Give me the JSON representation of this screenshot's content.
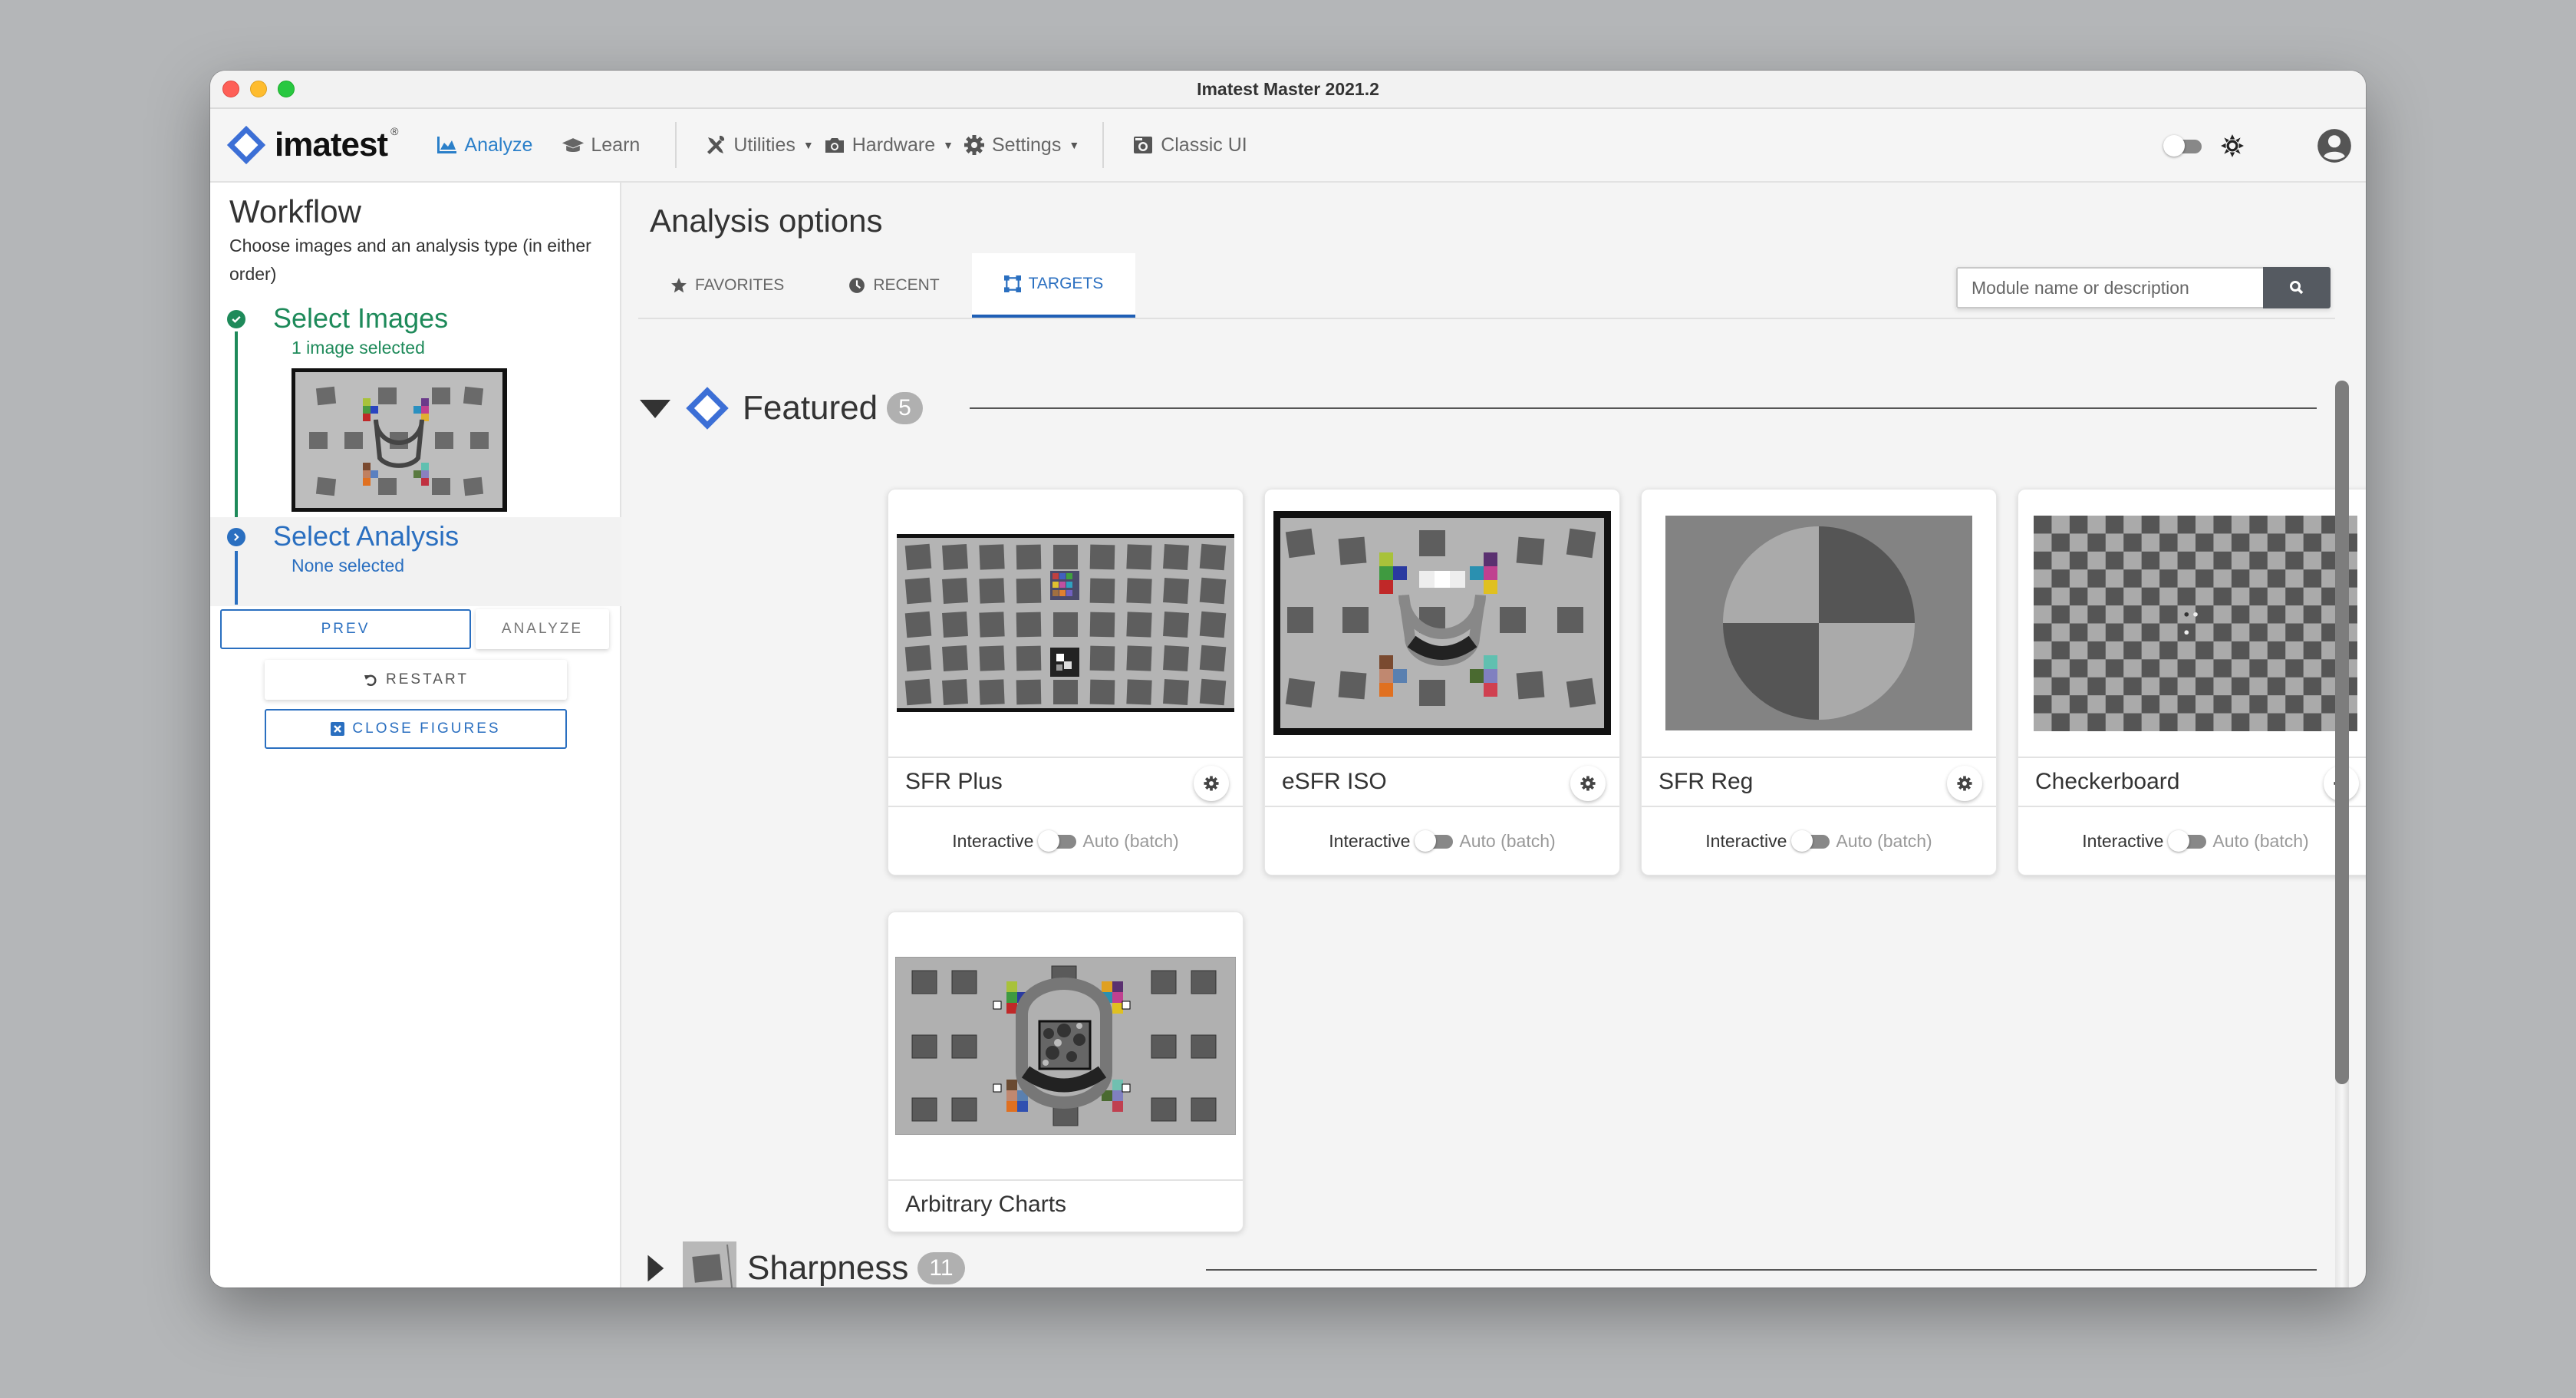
{
  "window": {
    "title": "Imatest Master 2021.2"
  },
  "toolbar": {
    "logo_text": "imatest",
    "logo_reg": "®",
    "nav": [
      {
        "label": "Analyze",
        "icon": "area-chart-icon",
        "active": true
      },
      {
        "label": "Learn",
        "icon": "graduation-cap-icon",
        "active": false
      }
    ],
    "menus": [
      {
        "label": "Utilities",
        "icon": "tools-icon",
        "has_caret": true
      },
      {
        "label": "Hardware",
        "icon": "camera-icon",
        "has_caret": true
      },
      {
        "label": "Settings",
        "icon": "gear-icon",
        "has_caret": true
      }
    ],
    "classic_ui_label": "Classic UI",
    "theme_toggle_on": false
  },
  "sidebar": {
    "title": "Workflow",
    "description": "Choose images and an analysis type (in either order)",
    "steps": [
      {
        "title": "Select Images",
        "subtitle": "1 image selected",
        "status": "complete",
        "color": "#1e8a5a"
      },
      {
        "title": "Select Analysis",
        "subtitle": "None selected",
        "status": "current",
        "color": "#2a6fc0"
      }
    ],
    "buttons": {
      "prev": "PREV",
      "analyze": "ANALYZE",
      "restart": "RESTART",
      "close_figures": "CLOSE FIGURES"
    }
  },
  "main": {
    "title": "Analysis options",
    "tabs": [
      {
        "label": "FAVORITES",
        "icon": "star-icon",
        "active": false
      },
      {
        "label": "RECENT",
        "icon": "clock-icon",
        "active": false
      },
      {
        "label": "TARGETS",
        "icon": "target-frame-icon",
        "active": true
      }
    ],
    "search": {
      "placeholder": "Module name or description",
      "value": ""
    },
    "sections": [
      {
        "title": "Featured",
        "count": "5",
        "expanded": true,
        "cards": [
          {
            "name": "SFR Plus",
            "mode_left": "Interactive",
            "mode_right": "Auto (batch)",
            "auto_batch": false,
            "has_settings": true
          },
          {
            "name": "eSFR ISO",
            "mode_left": "Interactive",
            "mode_right": "Auto (batch)",
            "auto_batch": false,
            "has_settings": true
          },
          {
            "name": "SFR Reg",
            "mode_left": "Interactive",
            "mode_right": "Auto (batch)",
            "auto_batch": false,
            "has_settings": true
          },
          {
            "name": "Checkerboard",
            "mode_left": "Interactive",
            "mode_right": "Auto (batch)",
            "auto_batch": false,
            "has_settings": true
          },
          {
            "name": "Arbitrary Charts",
            "has_settings": false
          }
        ]
      },
      {
        "title": "Sharpness",
        "count": "11",
        "expanded": false
      }
    ],
    "scroll_position": 0.0,
    "scroll_visible_fraction": 0.75
  },
  "colors": {
    "accent_blue": "#2a6fc0",
    "success_green": "#1e8a5a",
    "search_button": "#555a61"
  }
}
